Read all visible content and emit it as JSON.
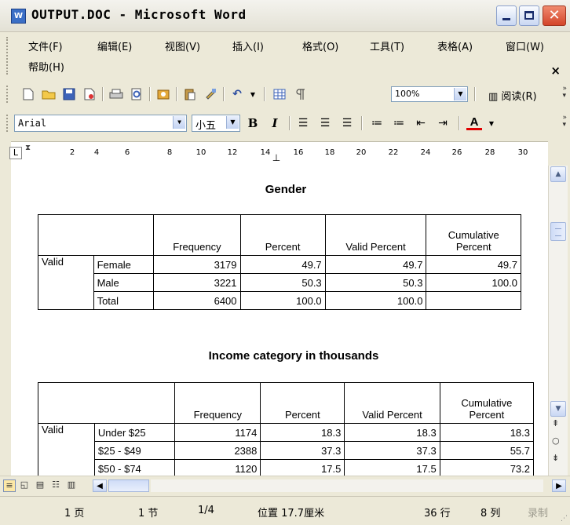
{
  "window": {
    "title": "OUTPUT.DOC - Microsoft Word",
    "app_icon_text": "W"
  },
  "menubar": {
    "items": [
      "文件(F)",
      "编辑(E)",
      "视图(V)",
      "插入(I)",
      "格式(O)",
      "工具(T)",
      "表格(A)",
      "窗口(W)",
      "帮助(H)"
    ],
    "close_glyph": "×"
  },
  "standard_toolbar": {
    "zoom_value": "100%",
    "read_label": "阅读(R)"
  },
  "format_toolbar": {
    "font_name": "Arial",
    "font_size": "小五",
    "bold_label": "B",
    "italic_label": "I",
    "font_color_label": "A"
  },
  "ruler": {
    "numbers": [
      "2",
      "4",
      "6",
      "8",
      "10",
      "12",
      "14",
      "16",
      "18",
      "20",
      "22",
      "24",
      "26",
      "28",
      "30"
    ]
  },
  "document": {
    "table1": {
      "title": "Gender",
      "headers": [
        "Frequency",
        "Percent",
        "Valid Percent",
        "Cumulative Percent"
      ],
      "group_label": "Valid",
      "rows": [
        {
          "label": "Female",
          "frequency": "3179",
          "percent": "49.7",
          "valid_percent": "49.7",
          "cumulative": "49.7"
        },
        {
          "label": "Male",
          "frequency": "3221",
          "percent": "50.3",
          "valid_percent": "50.3",
          "cumulative": "100.0"
        },
        {
          "label": "Total",
          "frequency": "6400",
          "percent": "100.0",
          "valid_percent": "100.0",
          "cumulative": ""
        }
      ]
    },
    "table2": {
      "title": "Income category in thousands",
      "headers": [
        "Frequency",
        "Percent",
        "Valid Percent",
        "Cumulative Percent"
      ],
      "group_label": "Valid",
      "rows": [
        {
          "label": "Under $25",
          "frequency": "1174",
          "percent": "18.3",
          "valid_percent": "18.3",
          "cumulative": "18.3"
        },
        {
          "label": "$25 - $49",
          "frequency": "2388",
          "percent": "37.3",
          "valid_percent": "37.3",
          "cumulative": "55.7"
        },
        {
          "label": "$50 - $74",
          "frequency": "1120",
          "percent": "17.5",
          "valid_percent": "17.5",
          "cumulative": "73.2"
        }
      ]
    }
  },
  "statusbar": {
    "page": "1 页",
    "section": "1 节",
    "page_of": "1/4",
    "position": "位置 17.7厘米",
    "line": "36 行",
    "column": "8 列",
    "record": "录制"
  },
  "colors": {
    "title_bg": "#ece9d8",
    "close_red": "#d3452a",
    "accent_blue": "#3b6fc6"
  }
}
